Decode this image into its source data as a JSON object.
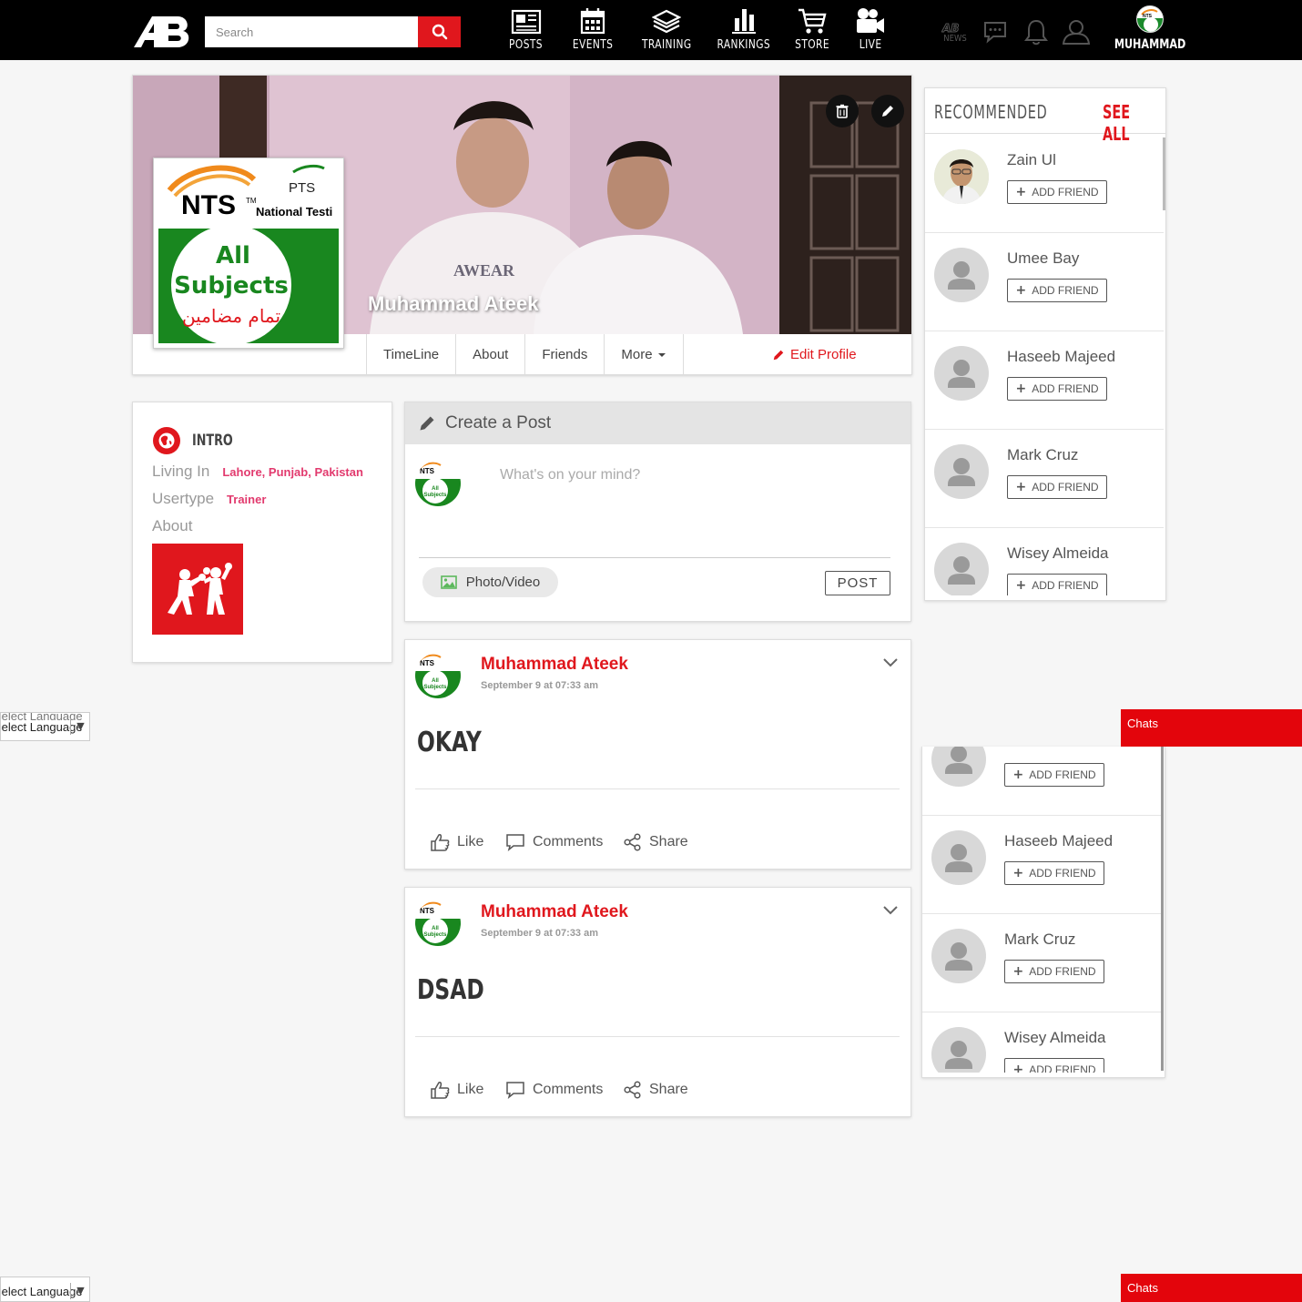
{
  "search": {
    "placeholder": "Search"
  },
  "nav": [
    {
      "label": "POSTS",
      "icon": "newspaper-icon"
    },
    {
      "label": "EVENTS",
      "icon": "calendar-icon"
    },
    {
      "label": "TRAINING",
      "icon": "ring-icon"
    },
    {
      "label": "RANKINGS",
      "icon": "bar-chart-icon"
    },
    {
      "label": "STORE",
      "icon": "cart-icon"
    },
    {
      "label": "LIVE",
      "icon": "video-camera-icon"
    }
  ],
  "topbar": {
    "news_label": "NEWS",
    "user_label": "MUHAMMAD",
    "icons": [
      "news-icon",
      "chat-bubble-icon",
      "bell-icon",
      "user-icon"
    ]
  },
  "profile": {
    "name": "Muhammad Ateek",
    "tabs": [
      "TimeLine",
      "About",
      "Friends",
      "More"
    ],
    "edit_label": "Edit Profile",
    "pic_text": {
      "brand": "NTS",
      "tm": "TM",
      "org": "National Testi",
      "pts": "PTS",
      "line1": "All",
      "line2": "Subjects",
      "urdu": "تمام مضامین"
    }
  },
  "intro": {
    "title": "INTRO",
    "rows": [
      {
        "key": "Living In",
        "value": "Lahore, Punjab, Pakistan"
      },
      {
        "key": "Usertype",
        "value": "Trainer"
      },
      {
        "key": "About",
        "value": ""
      }
    ]
  },
  "create_post": {
    "title": "Create a Post",
    "placeholder": "What's on your mind?",
    "photo_label": "Photo/Video",
    "post_label": "POST"
  },
  "posts": [
    {
      "author": "Muhammad Ateek",
      "time": "September 9 at 07:33 am",
      "text": "OKAY"
    },
    {
      "author": "Muhammad Ateek",
      "time": "September 9 at 07:33 am",
      "text": "DSAD"
    }
  ],
  "post_actions": {
    "like": "Like",
    "comments": "Comments",
    "share": "Share"
  },
  "recommended": {
    "title": "RECOMMENDED",
    "see_all": "SEE ALL",
    "add_label": "ADD FRIEND",
    "people": [
      "Zain Ul",
      "Umee Bay",
      "Haseeb Majeed",
      "Mark Cruz",
      "Wisey Almeida"
    ]
  },
  "language": {
    "label": "Select Language"
  },
  "chats": {
    "label": "Chats"
  },
  "colors": {
    "brand_red": "#e0171d",
    "pink": "#e23a6e",
    "topbar": "#000000"
  }
}
